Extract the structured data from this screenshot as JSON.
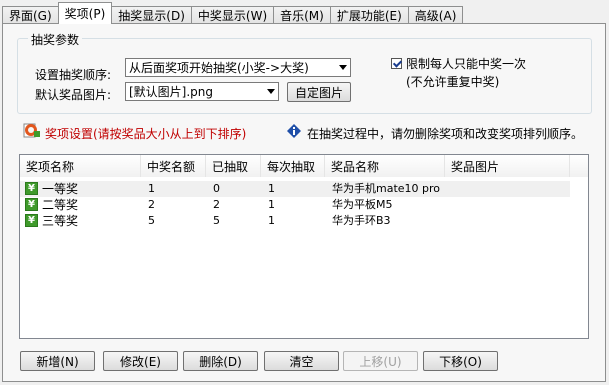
{
  "tabs": [
    {
      "label": "界面(G)"
    },
    {
      "label": "奖项(P)"
    },
    {
      "label": "抽奖显示(D)"
    },
    {
      "label": "中奖显示(W)"
    },
    {
      "label": "音乐(M)"
    },
    {
      "label": "扩展功能(E)"
    },
    {
      "label": "高级(A)"
    }
  ],
  "active_tab": "奖项(P)",
  "params": {
    "legend": "抽奖参数",
    "order_label": "设置抽奖顺序:",
    "order_value": "从后面奖项开始抽奖(小奖->大奖)",
    "image_label": "默认奖品图片:",
    "image_value": "[默认图片].png",
    "custom_image_button": "自定图片",
    "limit_checkbox_label": "限制每人只能中奖一次",
    "limit_checkbox_checked": true,
    "limit_note": "(不允许重复中奖)"
  },
  "prize_settings": {
    "title": "奖项设置(请按奖品大小从上到下排序)",
    "info": "在抽奖过程中，请勿删除奖项和改变奖项排列顺序。"
  },
  "table": {
    "columns": [
      "奖项名称",
      "中奖名额",
      "已抽取",
      "每次抽取",
      "奖品名称",
      "奖品图片"
    ],
    "rows": [
      {
        "name": "一等奖",
        "quota": "1",
        "drawn": "0",
        "per_draw": "1",
        "prize": "华为手机mate10 pro",
        "image": ""
      },
      {
        "name": "二等奖",
        "quota": "2",
        "drawn": "2",
        "per_draw": "1",
        "prize": "华为平板M5",
        "image": ""
      },
      {
        "name": "三等奖",
        "quota": "5",
        "drawn": "5",
        "per_draw": "1",
        "prize": "华为手环B3",
        "image": ""
      }
    ]
  },
  "buttons": {
    "add": "新增(N)",
    "edit": "修改(E)",
    "delete": "删除(D)",
    "clear": "清空",
    "move_up": "上移(U)",
    "move_down": "下移(O)"
  },
  "icons": {
    "prize_icon": "yen-prize-icon",
    "settings_icon": "prize-settings-icon",
    "info_icon": "info-icon"
  },
  "colors": {
    "prize_settings_text": "#c00000",
    "icon_green": "#3f9a2b",
    "info_blue": "#1f4fa8"
  }
}
